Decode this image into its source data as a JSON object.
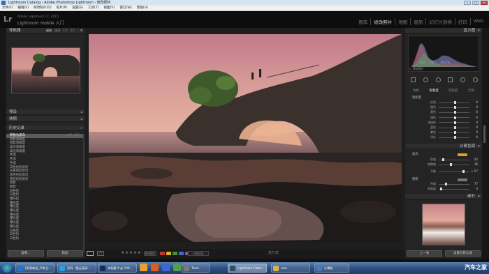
{
  "window": {
    "title": "Lightroom Catalog - Adobe Photoshop Lightroom - 修改照片"
  },
  "menu": [
    "文件(F)",
    "编辑(E)",
    "修改照片(D)",
    "照片(P)",
    "设置(S)",
    "工具(T)",
    "视图(V)",
    "窗口(W)",
    "帮助(H)"
  ],
  "identity": {
    "logo": "Lr",
    "line1": "Adobe Lightroom CC 2015",
    "line2": "Lightroom mobile 入门",
    "modules": [
      "图库",
      "修改照片",
      "地图",
      "画册",
      "幻灯片放映",
      "打印",
      "Web"
    ],
    "active_module": "修改照片"
  },
  "left_panel": {
    "navigator": {
      "title": "导航器",
      "tabs": [
        "适合",
        "填满",
        "1:1",
        "3:1"
      ]
    },
    "presets": "预设",
    "snapshots": "快照",
    "history": {
      "title": "历史记录",
      "items": [
        {
          "label": "转换为黑白",
          "v1": "+17",
          "v2": "17"
        },
        {
          "label": "阴影清晰度",
          "v1": "",
          "v2": ""
        },
        {
          "label": "阴影清晰度",
          "v1": "",
          "v2": ""
        },
        {
          "label": "高光清晰度",
          "v1": "",
          "v2": ""
        },
        {
          "label": "高光清晰度",
          "v1": "",
          "v2": ""
        },
        {
          "label": "色温",
          "v1": "",
          "v2": ""
        },
        {
          "label": "色温",
          "v1": "",
          "v2": ""
        },
        {
          "label": "色温",
          "v1": "",
          "v2": ""
        },
        {
          "label": "白色色阶剪切",
          "v1": "",
          "v2": ""
        },
        {
          "label": "白色色阶剪切",
          "v1": "",
          "v2": ""
        },
        {
          "label": "黑色色阶剪切",
          "v1": "",
          "v2": ""
        },
        {
          "label": "黑色色阶剪切",
          "v1": "",
          "v2": ""
        },
        {
          "label": "阴影",
          "v1": "",
          "v2": ""
        },
        {
          "label": "阴影",
          "v1": "",
          "v2": ""
        },
        {
          "label": "白色阶",
          "v1": "",
          "v2": ""
        },
        {
          "label": "白色阶",
          "v1": "",
          "v2": ""
        },
        {
          "label": "曝光度",
          "v1": "",
          "v2": ""
        },
        {
          "label": "曝光度",
          "v1": "",
          "v2": ""
        },
        {
          "label": "曝光度",
          "v1": "",
          "v2": ""
        },
        {
          "label": "曝光度",
          "v1": "",
          "v2": ""
        },
        {
          "label": "曝光度",
          "v1": "",
          "v2": ""
        },
        {
          "label": "曝光度",
          "v1": "",
          "v2": ""
        },
        {
          "label": "曝光度",
          "v1": "",
          "v2": ""
        },
        {
          "label": "曝光度",
          "v1": "",
          "v2": ""
        },
        {
          "label": "白色阶",
          "v1": "",
          "v2": ""
        },
        {
          "label": "白色阶",
          "v1": "",
          "v2": ""
        },
        {
          "label": "白色阶",
          "v1": "",
          "v2": ""
        }
      ]
    },
    "buttons": {
      "copy": "复制...",
      "paste": "粘贴"
    }
  },
  "toolbar": {
    "yy": "YY",
    "stars": "★★★★★",
    "flag": "修改照片",
    "compare": "分别对比",
    "colors": [
      "#c0392b",
      "#e0b020",
      "#3a9a3a",
      "#3a6fc0",
      "#8a4ab0"
    ],
    "status": "软打样"
  },
  "right_panel": {
    "histogram_title": "直方图",
    "histogram_values": [
      "13.0",
      "18.7",
      "16.4 %"
    ],
    "original_photo": "原始照片",
    "tabs": [
      "色相",
      "饱和度",
      "明亮度",
      "全部"
    ],
    "active_tab": "饱和度",
    "hsl_group": "饱和度",
    "hsl_sliders": [
      {
        "label": "红色",
        "value": "0",
        "pos": 0.5
      },
      {
        "label": "橙色",
        "value": "0",
        "pos": 0.5
      },
      {
        "label": "黄色",
        "value": "0",
        "pos": 0.5
      },
      {
        "label": "绿色",
        "value": "0",
        "pos": 0.5
      },
      {
        "label": "浅绿色",
        "value": "0",
        "pos": 0.5
      },
      {
        "label": "蓝色",
        "value": "0",
        "pos": 0.5
      },
      {
        "label": "紫色",
        "value": "0",
        "pos": 0.5
      },
      {
        "label": "洋红",
        "value": "0",
        "pos": 0.5
      }
    ],
    "split_title": "分离色调",
    "highlights": {
      "title": "高光",
      "hue": {
        "label": "色相",
        "value": "42",
        "pos": 0.12
      },
      "sat": {
        "label": "饱和度",
        "value": "36",
        "pos": 0.36
      }
    },
    "balance": {
      "label": "平衡",
      "value": "+ 57",
      "pos": 0.78
    },
    "shadows": {
      "title": "阴影",
      "hue": {
        "label": "色相",
        "value": "77",
        "pos": 0.21
      },
      "sat": {
        "label": "饱和度",
        "value": "4",
        "pos": 0.04
      }
    },
    "detail_title": "细节",
    "buttons": {
      "prev": "上一张",
      "reset": "设置为默认值"
    }
  },
  "taskbar": {
    "items": [
      {
        "label": "[发表新帖_汽车之...",
        "color": "#2a72c8"
      },
      {
        "label": "页码 - 酷云阅读...",
        "color": "#2aa0e0"
      },
      {
        "label": "未标题-4 @ 100...",
        "color": "#1a2a60"
      },
      {
        "label": "Team",
        "color": "#7a7a7a"
      },
      {
        "label": "Lightroom Catal...",
        "color": "#30506a"
      },
      {
        "label": "new",
        "color": "#d8b24a"
      },
      {
        "label": "计算机",
        "color": "#4a7ab8"
      }
    ],
    "watermark": "汽车之家"
  }
}
